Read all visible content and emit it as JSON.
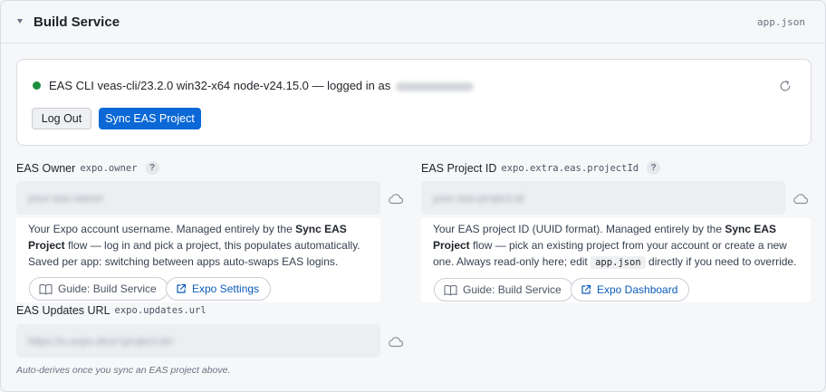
{
  "header": {
    "title": "Build Service",
    "file": "app.json"
  },
  "status": {
    "text": "EAS CLI veas-cli/23.2.0 win32-x64 node-v24.15.0 — logged in as",
    "dot_color": "#1e8e3e"
  },
  "buttons": {
    "logout": "Log Out",
    "sync": "Sync EAS Project"
  },
  "owner": {
    "label": "EAS Owner",
    "key": "expo.owner",
    "help": "?",
    "placeholder": "your-eas-owner",
    "desc_1": "Your Expo account username. Managed entirely by the ",
    "desc_bold": "Sync EAS Project",
    "desc_2": " flow — log in and pick a project, this populates automatically. Saved per app: switching between apps auto-swaps EAS logins.",
    "guide_label": "Guide: Build Service",
    "link_label": "Expo Settings"
  },
  "project": {
    "label": "EAS Project ID",
    "key": "expo.extra.eas.projectId",
    "help": "?",
    "placeholder": "your-eas-project-id",
    "desc_1": "Your EAS project ID (UUID format). Managed entirely by the ",
    "desc_bold": "Sync EAS Project",
    "desc_2": " flow — pick an existing project from your account or create a new one. Always read-only here; edit ",
    "desc_code": "app.json",
    "desc_3": " directly if you need to override.",
    "guide_label": "Guide: Build Service",
    "link_label": "Expo Dashboard"
  },
  "updates": {
    "label": "EAS Updates URL",
    "key": "expo.updates.url",
    "placeholder": "https://u.expo.dev/<project-id>",
    "hint": "Auto-derives once you sync an EAS project above."
  },
  "colors": {
    "accent": "#0b68d6",
    "link": "#0b5cb8"
  }
}
